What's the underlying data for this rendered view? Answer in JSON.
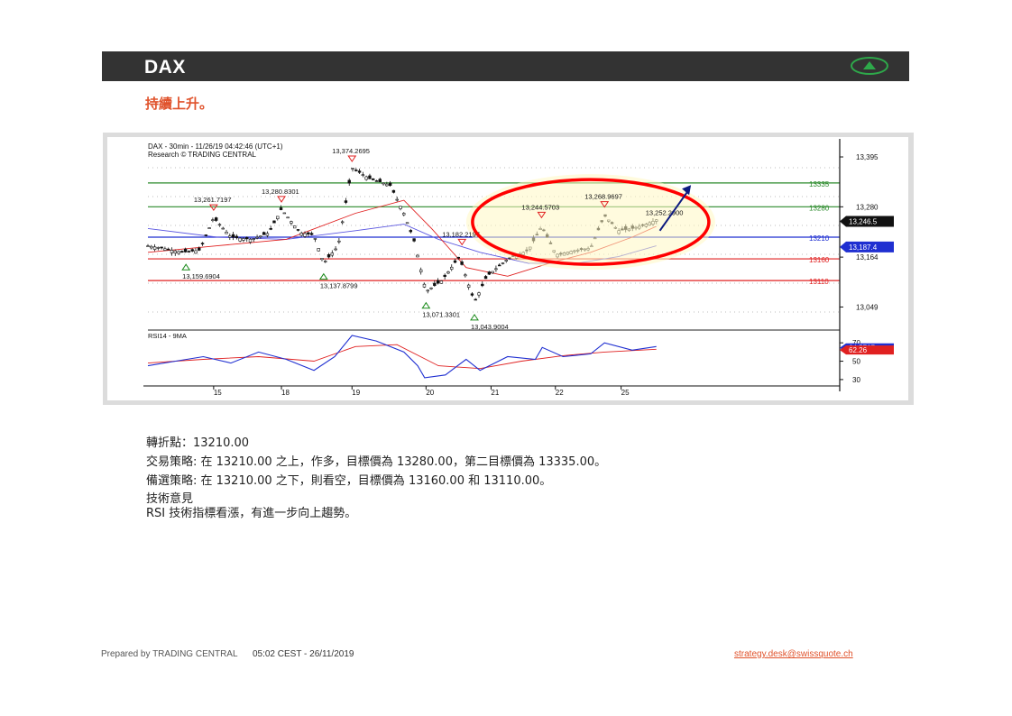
{
  "header": {
    "title": "DAX",
    "trend_icon": "up-arrow-icon",
    "accent": "#2ea84a"
  },
  "subtitle": "持續上升。",
  "chart_data": {
    "type": "candlestick",
    "title": "DAX - 30min - 11/26/19 04:42:46 (UTC+1)",
    "subtitle": "Research © TRADING CENTRAL",
    "ylim": [
      13000,
      13420
    ],
    "y_ticks": [
      "13,395",
      "13,280",
      "13,164",
      "13,049"
    ],
    "x_ticks": [
      "15",
      "18",
      "19",
      "20",
      "21",
      "22",
      "25"
    ],
    "levels": [
      {
        "label": "13335",
        "value": 13335,
        "color": "#2a8a2a"
      },
      {
        "label": "13280",
        "value": 13280,
        "color": "#2a8a2a"
      },
      {
        "label": "13210",
        "value": 13210,
        "color": "#1f2fd1"
      },
      {
        "label": "13160",
        "value": 13160,
        "color": "#e02020"
      },
      {
        "label": "13110",
        "value": 13110,
        "color": "#e02020"
      }
    ],
    "price_tags": [
      {
        "label": "13,246.5",
        "value": 13246.5,
        "color": "#111111"
      },
      {
        "label": "13,187.4",
        "value": 13187.4,
        "color": "#1f2fd1"
      }
    ],
    "annotations": [
      {
        "label": "13,374.2695",
        "marker": "high",
        "x": 0.295,
        "value": 13374.27
      },
      {
        "label": "13,261.7197",
        "marker": "high",
        "x": 0.095,
        "value": 13261.72
      },
      {
        "label": "13,280.8301",
        "marker": "high",
        "x": 0.193,
        "value": 13280.83
      },
      {
        "label": "13,159.6904",
        "marker": "low",
        "x": 0.055,
        "value": 13159.69
      },
      {
        "label": "13,137.8799",
        "marker": "low",
        "x": 0.254,
        "value": 13137.88
      },
      {
        "label": "13,071.3301",
        "marker": "low",
        "x": 0.402,
        "value": 13071.33
      },
      {
        "label": "13,043.9004",
        "marker": "low",
        "x": 0.472,
        "value": 13043.9
      },
      {
        "label": "13,182.2197",
        "marker": "high",
        "x": 0.454,
        "value": 13182.22
      },
      {
        "label": "13,244.5703",
        "marker": "high",
        "x": 0.569,
        "value": 13244.57
      },
      {
        "label": "13,268.9697",
        "marker": "high",
        "x": 0.66,
        "value": 13268.97
      },
      {
        "label": "13,252.2900",
        "marker": "none",
        "x": 0.735,
        "value": 13252.29
      }
    ],
    "price_path": [
      [
        0.0,
        13190
      ],
      [
        0.02,
        13185
      ],
      [
        0.05,
        13175
      ],
      [
        0.075,
        13180
      ],
      [
        0.095,
        13255
      ],
      [
        0.12,
        13210
      ],
      [
        0.15,
        13205
      ],
      [
        0.175,
        13220
      ],
      [
        0.193,
        13275
      ],
      [
        0.22,
        13220
      ],
      [
        0.24,
        13215
      ],
      [
        0.254,
        13150
      ],
      [
        0.275,
        13190
      ],
      [
        0.295,
        13370
      ],
      [
        0.32,
        13345
      ],
      [
        0.35,
        13330
      ],
      [
        0.37,
        13265
      ],
      [
        0.385,
        13200
      ],
      [
        0.402,
        13085
      ],
      [
        0.425,
        13110
      ],
      [
        0.45,
        13165
      ],
      [
        0.472,
        13060
      ],
      [
        0.49,
        13120
      ],
      [
        0.52,
        13160
      ],
      [
        0.55,
        13180
      ],
      [
        0.569,
        13235
      ],
      [
        0.59,
        13170
      ],
      [
        0.62,
        13180
      ],
      [
        0.64,
        13185
      ],
      [
        0.66,
        13260
      ],
      [
        0.68,
        13225
      ],
      [
        0.7,
        13230
      ],
      [
        0.72,
        13240
      ],
      [
        0.735,
        13250
      ]
    ],
    "ma_red": [
      [
        0.0,
        13175
      ],
      [
        0.1,
        13190
      ],
      [
        0.2,
        13205
      ],
      [
        0.3,
        13265
      ],
      [
        0.37,
        13295
      ],
      [
        0.41,
        13230
      ],
      [
        0.46,
        13140
      ],
      [
        0.52,
        13120
      ],
      [
        0.58,
        13150
      ],
      [
        0.64,
        13175
      ],
      [
        0.7,
        13210
      ],
      [
        0.735,
        13235
      ]
    ],
    "ma_blue": [
      [
        0.0,
        13230
      ],
      [
        0.1,
        13210
      ],
      [
        0.2,
        13205
      ],
      [
        0.3,
        13225
      ],
      [
        0.37,
        13240
      ],
      [
        0.42,
        13205
      ],
      [
        0.48,
        13175
      ],
      [
        0.55,
        13150
      ],
      [
        0.62,
        13150
      ],
      [
        0.68,
        13165
      ],
      [
        0.735,
        13190
      ]
    ],
    "rsi": {
      "label": "RSI14 - 9MA",
      "ylim": [
        25,
        80
      ],
      "y_ticks": [
        70,
        50,
        30
      ],
      "value_tags": [
        {
          "label": "64.5767",
          "value": 64.58,
          "color": "#1f2fd1"
        },
        {
          "label": "62.26",
          "value": 62.26,
          "color": "#e02020"
        }
      ],
      "rsi_path": [
        [
          0.0,
          45
        ],
        [
          0.04,
          50
        ],
        [
          0.08,
          55
        ],
        [
          0.12,
          48
        ],
        [
          0.16,
          60
        ],
        [
          0.2,
          52
        ],
        [
          0.24,
          40
        ],
        [
          0.27,
          55
        ],
        [
          0.295,
          78
        ],
        [
          0.33,
          72
        ],
        [
          0.37,
          60
        ],
        [
          0.39,
          45
        ],
        [
          0.4,
          32
        ],
        [
          0.43,
          35
        ],
        [
          0.46,
          52
        ],
        [
          0.48,
          40
        ],
        [
          0.52,
          55
        ],
        [
          0.56,
          52
        ],
        [
          0.57,
          65
        ],
        [
          0.6,
          55
        ],
        [
          0.64,
          58
        ],
        [
          0.66,
          70
        ],
        [
          0.7,
          62
        ],
        [
          0.735,
          66
        ]
      ],
      "ma_path": [
        [
          0.0,
          48
        ],
        [
          0.08,
          52
        ],
        [
          0.16,
          55
        ],
        [
          0.24,
          50
        ],
        [
          0.3,
          66
        ],
        [
          0.36,
          68
        ],
        [
          0.42,
          45
        ],
        [
          0.48,
          42
        ],
        [
          0.54,
          50
        ],
        [
          0.6,
          56
        ],
        [
          0.66,
          60
        ],
        [
          0.735,
          63
        ]
      ]
    }
  },
  "body": {
    "pivot": "轉折點：13210.00",
    "strategy": "交易策略: 在 13210.00 之上，作多，目標價為 13280.00，第二目標價為 13335.00。",
    "alternative": "備選策略: 在 13210.00 之下，則看空，目標價為 13160.00 和 13110.00。",
    "comment_title": "技術意見",
    "comment": "RSI 技術指標看漲，有進一步向上趨勢。"
  },
  "footer": {
    "prepared_by": "Prepared by TRADING CENTRAL",
    "time": "05:02 CEST - 26/11/2019",
    "email": "strategy.desk@swissquote.ch"
  }
}
